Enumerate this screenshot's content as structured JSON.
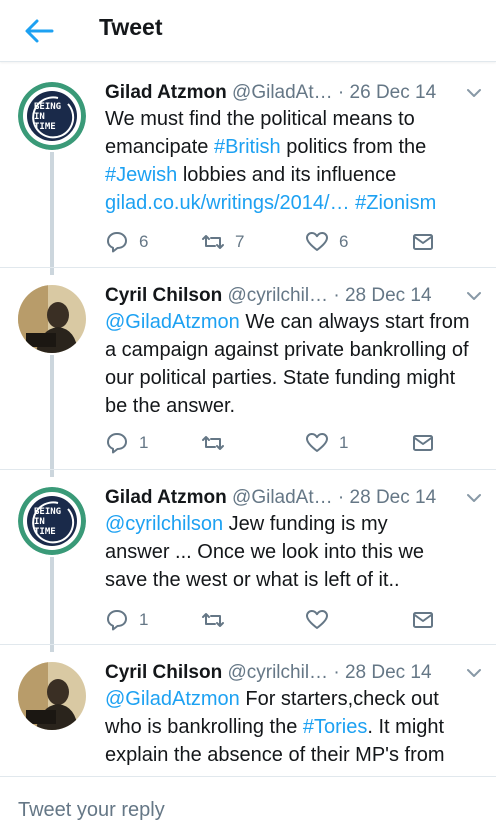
{
  "header": {
    "title": "Tweet"
  },
  "tweets": [
    {
      "name": "Gilad Atzmon",
      "handle": "@GiladAt…",
      "date": "26 Dec 14",
      "avatar_text": [
        "BEING",
        "IN",
        "TIME"
      ],
      "text": [
        {
          "t": "We must find the political means to emancipate ",
          "link": false
        },
        {
          "t": "#British",
          "link": true
        },
        {
          "t": " politics from the ",
          "link": false
        },
        {
          "t": "#Jewish",
          "link": true
        },
        {
          "t": " lobbies and its influence ",
          "link": false
        },
        {
          "t": "gilad.co.uk/writings/2014/…",
          "link": true
        },
        {
          "t": " ",
          "link": false
        },
        {
          "t": "#Zionism",
          "link": true
        }
      ],
      "replies": "6",
      "retweets": "7",
      "likes": "6"
    },
    {
      "name": "Cyril  Chilson",
      "handle": "@cyrilchil…",
      "date": "28 Dec 14",
      "text": [
        {
          "t": "@GiladAtzmon",
          "link": true
        },
        {
          "t": " We can always start from a campaign against private bankrolling of our political parties. State funding might be the answer.",
          "link": false
        }
      ],
      "replies": "1",
      "retweets": "",
      "likes": "1"
    },
    {
      "name": "Gilad Atzmon",
      "handle": "@GiladAt…",
      "date": "28 Dec 14",
      "avatar_text": [
        "BEING",
        "IN",
        "TIME"
      ],
      "text": [
        {
          "t": "@cyrilchilson",
          "link": true
        },
        {
          "t": " Jew funding is my answer ... Once we look into this we save the west or what is left of it..",
          "link": false
        }
      ],
      "replies": "1",
      "retweets": "",
      "likes": ""
    },
    {
      "name": "Cyril  Chilson",
      "handle": "@cyrilchil…",
      "date": "28 Dec 14",
      "text": [
        {
          "t": "@GiladAtzmon",
          "link": true
        },
        {
          "t": " For starters,check out who is bankrolling the ",
          "link": false
        },
        {
          "t": "#Tories",
          "link": true
        },
        {
          "t": ". It might explain the absence of their MP's from",
          "link": false
        }
      ],
      "replies": "",
      "retweets": "",
      "likes": ""
    }
  ],
  "reply": {
    "placeholder": "Tweet your reply"
  },
  "colors": {
    "link": "#1da1f2",
    "muted": "#657786",
    "text": "#14171a",
    "divider": "#e1e8ed",
    "avatar_ring": "#3a9a78",
    "avatar_bg": "#1a2a4a"
  },
  "icons": {
    "back": "arrow-left-icon",
    "caret": "chevron-down-icon",
    "reply": "reply-bubble-icon",
    "retweet": "retweet-icon",
    "like": "heart-icon",
    "dm": "envelope-icon"
  }
}
